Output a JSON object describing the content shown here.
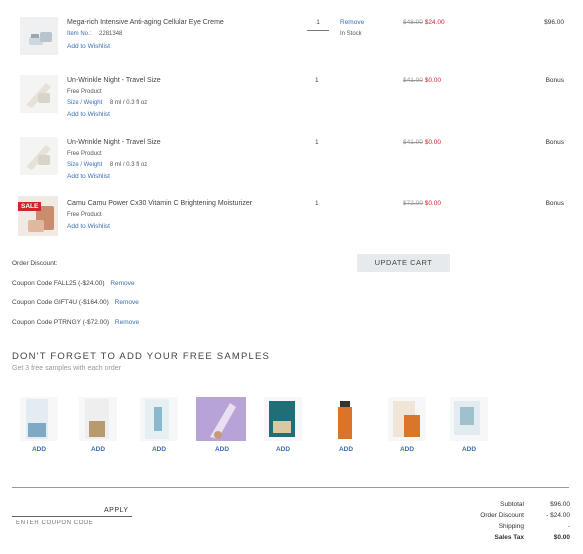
{
  "cart": {
    "items": [
      {
        "name": "Mega-rich Intensive Anti-aging Cellular Eye Creme",
        "item_no_label": "Item No.:",
        "item_no": "2281348",
        "wishlist": "Add to Wishlist",
        "qty": "1",
        "remove": "Remove",
        "stock": "In Stock",
        "price_old": "$48.00",
        "price_new": "$24.00",
        "total": "$96.00"
      },
      {
        "name": "Un-Wrinkle Night - Travel Size",
        "free": "Free Product",
        "size_label": "Size / Weight",
        "size_value": "8 ml / 0.3 fl oz",
        "wishlist": "Add to Wishlist",
        "qty": "1",
        "price_old": "$41.00",
        "price_new": "$0.00",
        "total": "Bonus"
      },
      {
        "name": "Un-Wrinkle Night - Travel Size",
        "free": "Free Product",
        "size_label": "Size / Weight",
        "size_value": "8 ml / 0.3 fl oz",
        "wishlist": "Add to Wishlist",
        "qty": "1",
        "price_old": "$41.00",
        "price_new": "$0.00",
        "total": "Bonus"
      },
      {
        "name": "Camu Camu Power Cx30 Vitamin C Brightening Moisturizer",
        "free": "Free Product",
        "wishlist": "Add to Wishlist",
        "qty": "1",
        "price_old": "$72.00",
        "price_new": "$0.00",
        "total": "Bonus",
        "badge": "SALE"
      }
    ],
    "order_discount_label": "Order Discount:",
    "update_cart": "UPDATE CART",
    "coupons": [
      {
        "text": "Coupon Code FALL25 (-$24.00)",
        "remove": "Remove"
      },
      {
        "text": "Coupon Code GIFT4U (-$164.00)",
        "remove": "Remove"
      },
      {
        "text": "Coupon Code PTRNGY (-$72.00)",
        "remove": "Remove"
      }
    ]
  },
  "samples": {
    "title": "DON'T FORGET TO ADD YOUR FREE SAMPLES",
    "subtitle": "Get 3 free samples with each order",
    "items": [
      {
        "add": "ADD"
      },
      {
        "add": "ADD"
      },
      {
        "add": "ADD"
      },
      {
        "add": "ADD"
      },
      {
        "add": "ADD"
      },
      {
        "add": "ADD"
      },
      {
        "add": "ADD"
      },
      {
        "add": "ADD"
      }
    ]
  },
  "coupon_entry": {
    "placeholder": "ENTER COUPON CODE",
    "apply": "APPLY"
  },
  "summary": {
    "subtotal_label": "Subtotal",
    "subtotal_value": "$96.00",
    "discount_label": "Order Discount",
    "discount_value": "- $24.00",
    "shipping_label": "Shipping",
    "shipping_value": "-",
    "tax_label": "Sales Tax",
    "tax_value": "$0.00"
  },
  "colors": {
    "link": "#3a6fb0",
    "sale_red": "#d0262a",
    "button_bg": "#e6eaec"
  }
}
